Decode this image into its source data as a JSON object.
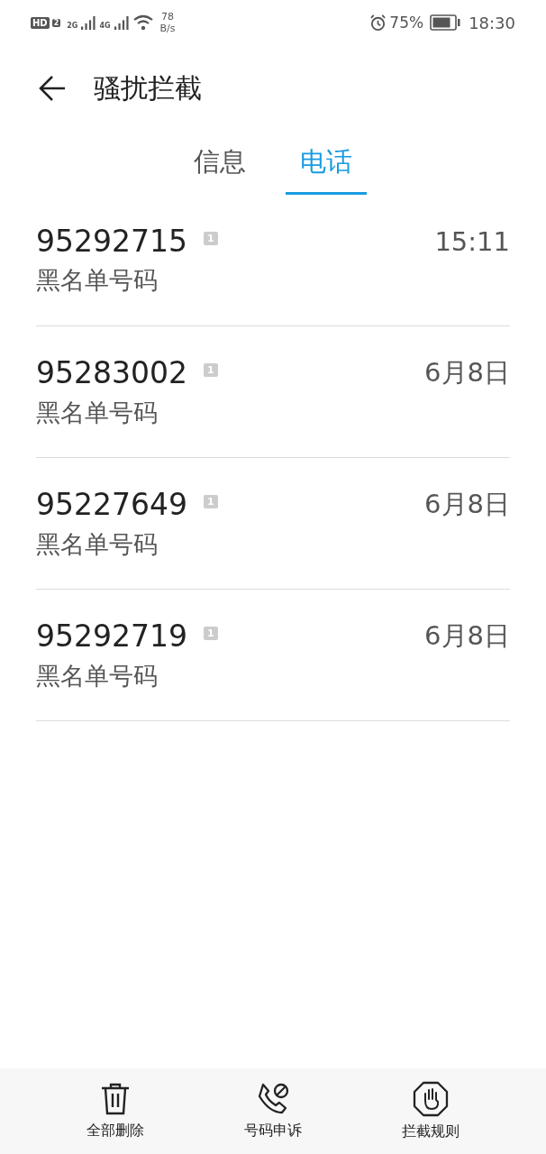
{
  "status_bar": {
    "hd": "HD",
    "hd_sim": "2",
    "network_1": "2G",
    "network_2": "4G",
    "speed_value": "78",
    "speed_unit": "B/s",
    "battery": "75%",
    "time": "18:30"
  },
  "header": {
    "title": "骚扰拦截"
  },
  "tabs": [
    {
      "label": "信息",
      "selected": false
    },
    {
      "label": "电话",
      "selected": true
    }
  ],
  "calls": [
    {
      "number": "95292715",
      "sim": "1",
      "label": "黑名单号码",
      "time": "15:11"
    },
    {
      "number": "95283002",
      "sim": "1",
      "label": "黑名单号码",
      "time": "6月8日"
    },
    {
      "number": "95227649",
      "sim": "1",
      "label": "黑名单号码",
      "time": "6月8日"
    },
    {
      "number": "95292719",
      "sim": "1",
      "label": "黑名单号码",
      "time": "6月8日"
    }
  ],
  "bottom_bar": [
    {
      "kind": "delete",
      "label": "全部删除"
    },
    {
      "kind": "appeal",
      "label": "号码申诉"
    },
    {
      "kind": "rules",
      "label": "拦截规则"
    }
  ]
}
